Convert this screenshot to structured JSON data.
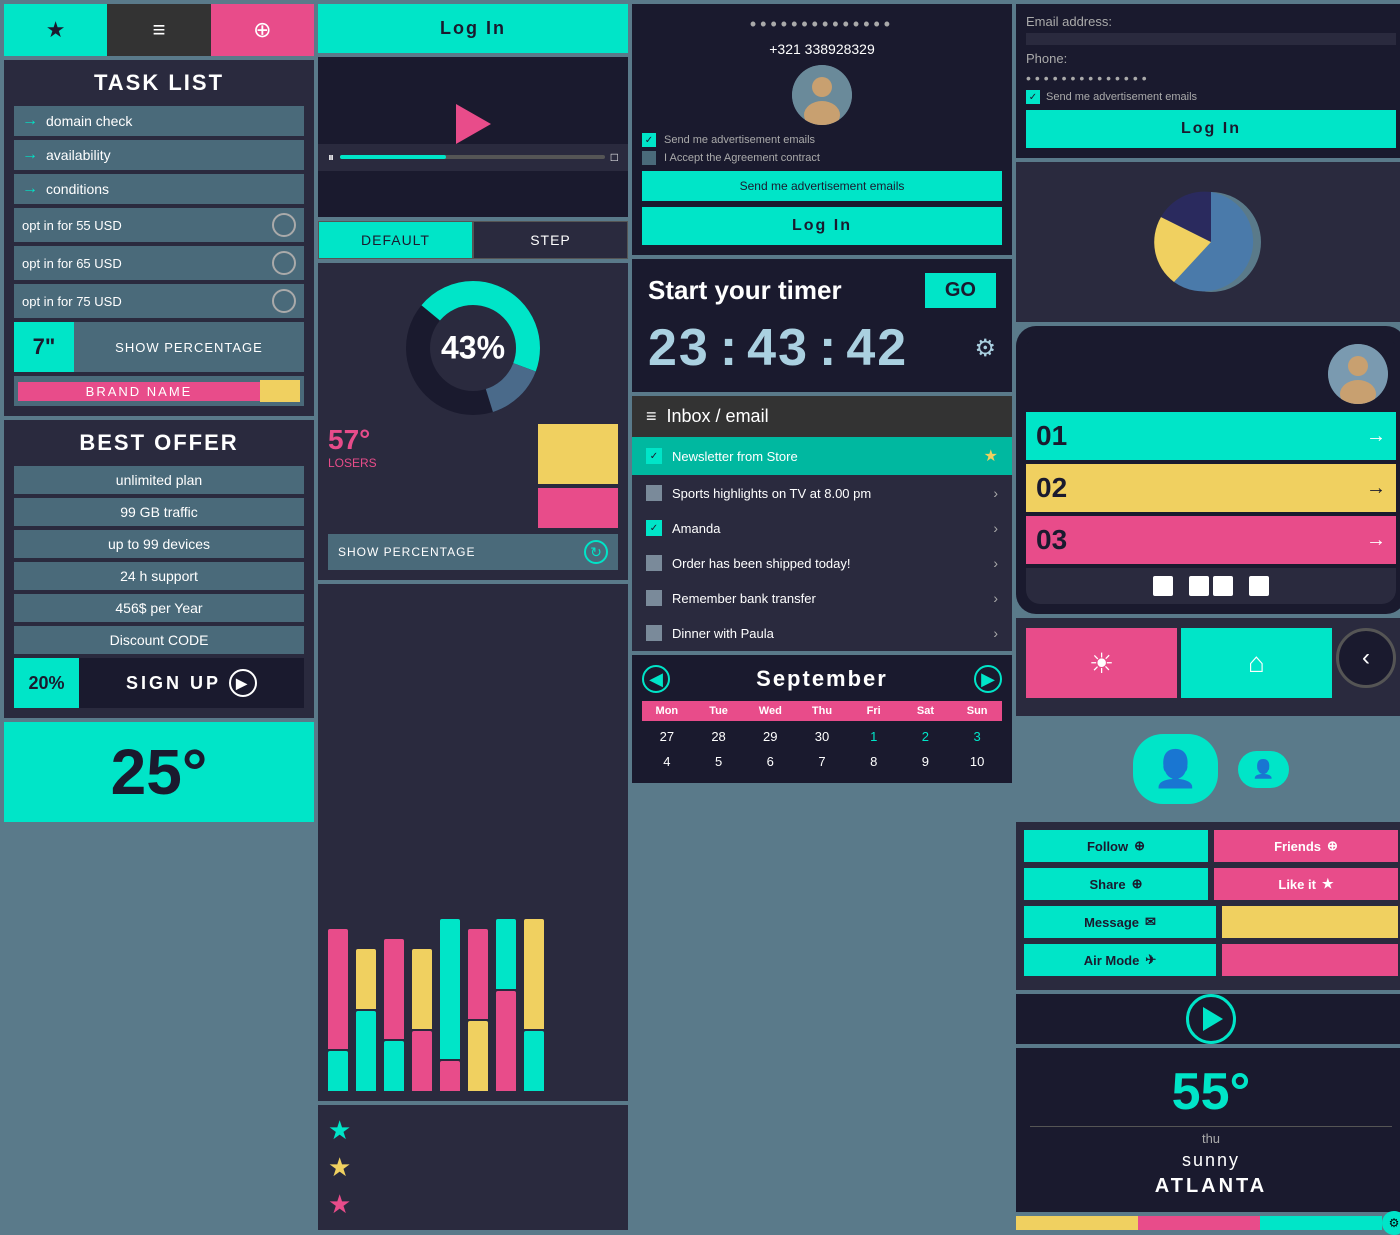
{
  "col1": {
    "nav": {
      "star": "★",
      "menu": "≡",
      "pin": "⊕"
    },
    "taskList": {
      "title": "TASK LIST",
      "items": [
        {
          "label": "domain check"
        },
        {
          "label": "availability"
        },
        {
          "label": "conditions"
        }
      ],
      "optItems": [
        {
          "label": "opt in for 55 USD"
        },
        {
          "label": "opt in for 65 USD"
        },
        {
          "label": "opt in for 75 USD"
        }
      ],
      "size": "7\"",
      "showPercentage": "SHOW PERCENTAGE",
      "brandName": "BRAND NAME"
    },
    "bestOffer": {
      "title": "BEST OFFER",
      "items": [
        "unlimited plan",
        "99 GB traffic",
        "up to 99 devices",
        "24 h support",
        "456$ per Year",
        "Discount CODE"
      ]
    },
    "signup": {
      "pct": "20%",
      "label": "SIGN UP",
      "icon": "▶"
    },
    "temp": "25°"
  },
  "col2": {
    "loginBtn": "Log In",
    "chart": {
      "pct": "43%",
      "losersLabel": "LOSERS",
      "losersValue": "57°",
      "showPercentage": "SHOW PERCENTAGE"
    },
    "tabs": {
      "default": "DEFAULT",
      "step": "STEP"
    }
  },
  "col3": {
    "loginForm": {
      "dots": "••••••••••••••",
      "phone": "+321 338928329",
      "checkbox1": "Send me advertisement emails",
      "checkbox2": "I Accept the Agreement contract",
      "sendAds": "Send me advertisement emails",
      "login": "Log In"
    },
    "timer": {
      "title": "Start your timer",
      "go": "GO",
      "hours": "23",
      "minutes": "43",
      "seconds": "42"
    },
    "inbox": {
      "title": "Inbox / email",
      "items": [
        {
          "text": "Newsletter from Store",
          "checked": true,
          "starred": true,
          "teal": true
        },
        {
          "text": "Sports highlights on TV at 8.00 pm",
          "checked": false,
          "starred": false,
          "teal": false
        },
        {
          "text": "Amanda",
          "checked": true,
          "starred": false,
          "teal": false
        },
        {
          "text": "Order has been shipped today!",
          "checked": false,
          "starred": false,
          "teal": false
        },
        {
          "text": "Remember bank transfer",
          "checked": false,
          "starred": false,
          "teal": false
        },
        {
          "text": "Dinner with Paula",
          "checked": false,
          "starred": false,
          "teal": false
        }
      ]
    },
    "calendar": {
      "title": "September",
      "dayLabels": [
        "Mon",
        "Tue",
        "Wed",
        "Thu",
        "Fri",
        "Sat",
        "Sun"
      ],
      "dates": [
        "27",
        "28",
        "29",
        "30",
        "1",
        "2",
        "3",
        "4",
        "5",
        "6",
        "7",
        "8",
        "9",
        "10"
      ]
    }
  },
  "col4": {
    "emailForm": {
      "emailLabel": "Email address:",
      "phoneLabel": "Phone:",
      "dots": "••••••••••••••",
      "checkboxLabel": "Send me advertisement emails",
      "loginBtn": "Log In"
    },
    "phoneWidget": {
      "items": [
        {
          "num": "01",
          "color": "cyan"
        },
        {
          "num": "02",
          "color": "yellow"
        },
        {
          "num": "03",
          "color": "pink"
        }
      ]
    },
    "social": {
      "follow": "Follow",
      "friends": "Friends",
      "share": "Share",
      "likeIt": "Like it",
      "message": "Message",
      "airMode": "Air Mode"
    },
    "weather": {
      "temp": "55°",
      "day": "thu",
      "condition": "sunny",
      "city": "ATLANTA"
    }
  }
}
